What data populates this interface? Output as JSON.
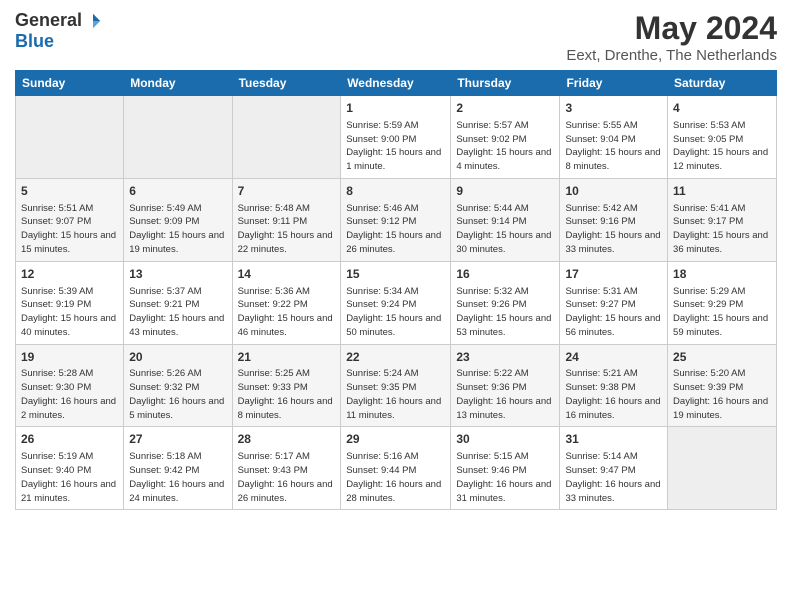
{
  "logo": {
    "general": "General",
    "blue": "Blue"
  },
  "title": "May 2024",
  "subtitle": "Eext, Drenthe, The Netherlands",
  "days_of_week": [
    "Sunday",
    "Monday",
    "Tuesday",
    "Wednesday",
    "Thursday",
    "Friday",
    "Saturday"
  ],
  "weeks": [
    [
      {
        "day": "",
        "info": ""
      },
      {
        "day": "",
        "info": ""
      },
      {
        "day": "",
        "info": ""
      },
      {
        "day": "1",
        "info": "Sunrise: 5:59 AM\nSunset: 9:00 PM\nDaylight: 15 hours and 1 minute."
      },
      {
        "day": "2",
        "info": "Sunrise: 5:57 AM\nSunset: 9:02 PM\nDaylight: 15 hours and 4 minutes."
      },
      {
        "day": "3",
        "info": "Sunrise: 5:55 AM\nSunset: 9:04 PM\nDaylight: 15 hours and 8 minutes."
      },
      {
        "day": "4",
        "info": "Sunrise: 5:53 AM\nSunset: 9:05 PM\nDaylight: 15 hours and 12 minutes."
      }
    ],
    [
      {
        "day": "5",
        "info": "Sunrise: 5:51 AM\nSunset: 9:07 PM\nDaylight: 15 hours and 15 minutes."
      },
      {
        "day": "6",
        "info": "Sunrise: 5:49 AM\nSunset: 9:09 PM\nDaylight: 15 hours and 19 minutes."
      },
      {
        "day": "7",
        "info": "Sunrise: 5:48 AM\nSunset: 9:11 PM\nDaylight: 15 hours and 22 minutes."
      },
      {
        "day": "8",
        "info": "Sunrise: 5:46 AM\nSunset: 9:12 PM\nDaylight: 15 hours and 26 minutes."
      },
      {
        "day": "9",
        "info": "Sunrise: 5:44 AM\nSunset: 9:14 PM\nDaylight: 15 hours and 30 minutes."
      },
      {
        "day": "10",
        "info": "Sunrise: 5:42 AM\nSunset: 9:16 PM\nDaylight: 15 hours and 33 minutes."
      },
      {
        "day": "11",
        "info": "Sunrise: 5:41 AM\nSunset: 9:17 PM\nDaylight: 15 hours and 36 minutes."
      }
    ],
    [
      {
        "day": "12",
        "info": "Sunrise: 5:39 AM\nSunset: 9:19 PM\nDaylight: 15 hours and 40 minutes."
      },
      {
        "day": "13",
        "info": "Sunrise: 5:37 AM\nSunset: 9:21 PM\nDaylight: 15 hours and 43 minutes."
      },
      {
        "day": "14",
        "info": "Sunrise: 5:36 AM\nSunset: 9:22 PM\nDaylight: 15 hours and 46 minutes."
      },
      {
        "day": "15",
        "info": "Sunrise: 5:34 AM\nSunset: 9:24 PM\nDaylight: 15 hours and 50 minutes."
      },
      {
        "day": "16",
        "info": "Sunrise: 5:32 AM\nSunset: 9:26 PM\nDaylight: 15 hours and 53 minutes."
      },
      {
        "day": "17",
        "info": "Sunrise: 5:31 AM\nSunset: 9:27 PM\nDaylight: 15 hours and 56 minutes."
      },
      {
        "day": "18",
        "info": "Sunrise: 5:29 AM\nSunset: 9:29 PM\nDaylight: 15 hours and 59 minutes."
      }
    ],
    [
      {
        "day": "19",
        "info": "Sunrise: 5:28 AM\nSunset: 9:30 PM\nDaylight: 16 hours and 2 minutes."
      },
      {
        "day": "20",
        "info": "Sunrise: 5:26 AM\nSunset: 9:32 PM\nDaylight: 16 hours and 5 minutes."
      },
      {
        "day": "21",
        "info": "Sunrise: 5:25 AM\nSunset: 9:33 PM\nDaylight: 16 hours and 8 minutes."
      },
      {
        "day": "22",
        "info": "Sunrise: 5:24 AM\nSunset: 9:35 PM\nDaylight: 16 hours and 11 minutes."
      },
      {
        "day": "23",
        "info": "Sunrise: 5:22 AM\nSunset: 9:36 PM\nDaylight: 16 hours and 13 minutes."
      },
      {
        "day": "24",
        "info": "Sunrise: 5:21 AM\nSunset: 9:38 PM\nDaylight: 16 hours and 16 minutes."
      },
      {
        "day": "25",
        "info": "Sunrise: 5:20 AM\nSunset: 9:39 PM\nDaylight: 16 hours and 19 minutes."
      }
    ],
    [
      {
        "day": "26",
        "info": "Sunrise: 5:19 AM\nSunset: 9:40 PM\nDaylight: 16 hours and 21 minutes."
      },
      {
        "day": "27",
        "info": "Sunrise: 5:18 AM\nSunset: 9:42 PM\nDaylight: 16 hours and 24 minutes."
      },
      {
        "day": "28",
        "info": "Sunrise: 5:17 AM\nSunset: 9:43 PM\nDaylight: 16 hours and 26 minutes."
      },
      {
        "day": "29",
        "info": "Sunrise: 5:16 AM\nSunset: 9:44 PM\nDaylight: 16 hours and 28 minutes."
      },
      {
        "day": "30",
        "info": "Sunrise: 5:15 AM\nSunset: 9:46 PM\nDaylight: 16 hours and 31 minutes."
      },
      {
        "day": "31",
        "info": "Sunrise: 5:14 AM\nSunset: 9:47 PM\nDaylight: 16 hours and 33 minutes."
      },
      {
        "day": "",
        "info": ""
      }
    ]
  ]
}
